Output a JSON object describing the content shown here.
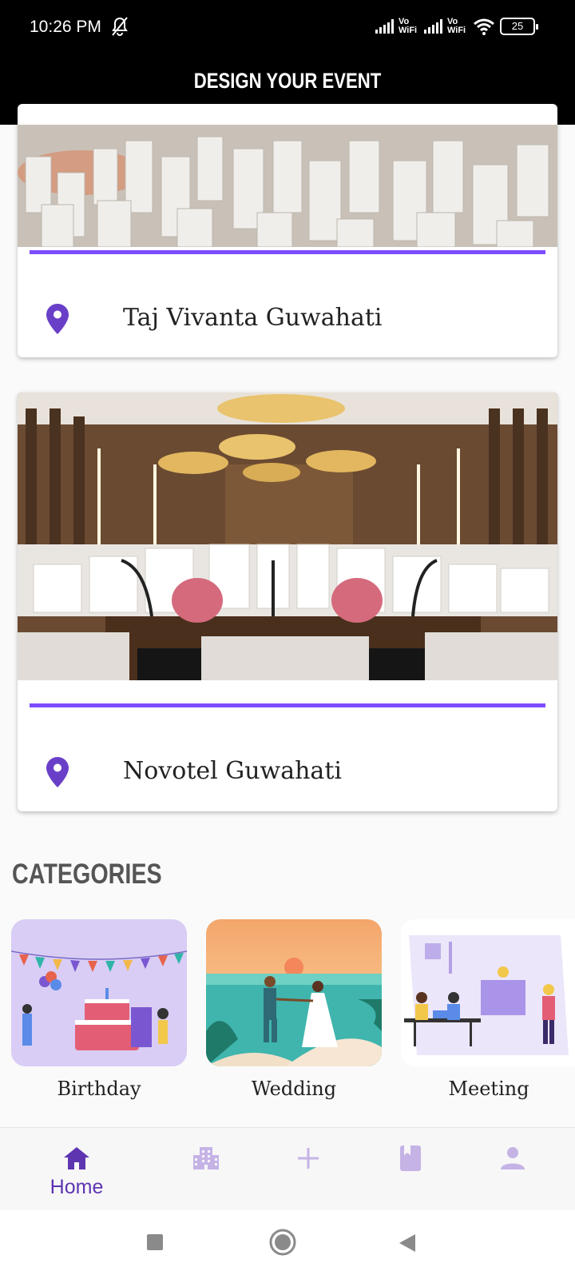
{
  "status_bar": {
    "time": "10:26 PM",
    "battery": "25",
    "network_label_1": "Vo\nWiFi",
    "network_label_2": "Vo\nWiFi"
  },
  "app_bar": {
    "title": "DESIGN YOUR EVENT"
  },
  "venues": [
    {
      "name": "Taj Vivanta Guwahati"
    },
    {
      "name": "Novotel Guwahati"
    }
  ],
  "categories": {
    "title": "CATEGORIES",
    "items": [
      {
        "label": "Birthday"
      },
      {
        "label": "Wedding"
      },
      {
        "label": "Meeting"
      }
    ]
  },
  "bottom_nav": {
    "items": [
      {
        "label": "Home",
        "icon": "home-icon",
        "active": true
      },
      {
        "label": "",
        "icon": "building-icon"
      },
      {
        "label": "",
        "icon": "plus-icon"
      },
      {
        "label": "",
        "icon": "book-icon"
      },
      {
        "label": "",
        "icon": "person-icon"
      }
    ]
  },
  "colors": {
    "accent": "#7c4dff",
    "nav_active": "#5e35b1",
    "nav_inactive": "#c5b3e6"
  }
}
